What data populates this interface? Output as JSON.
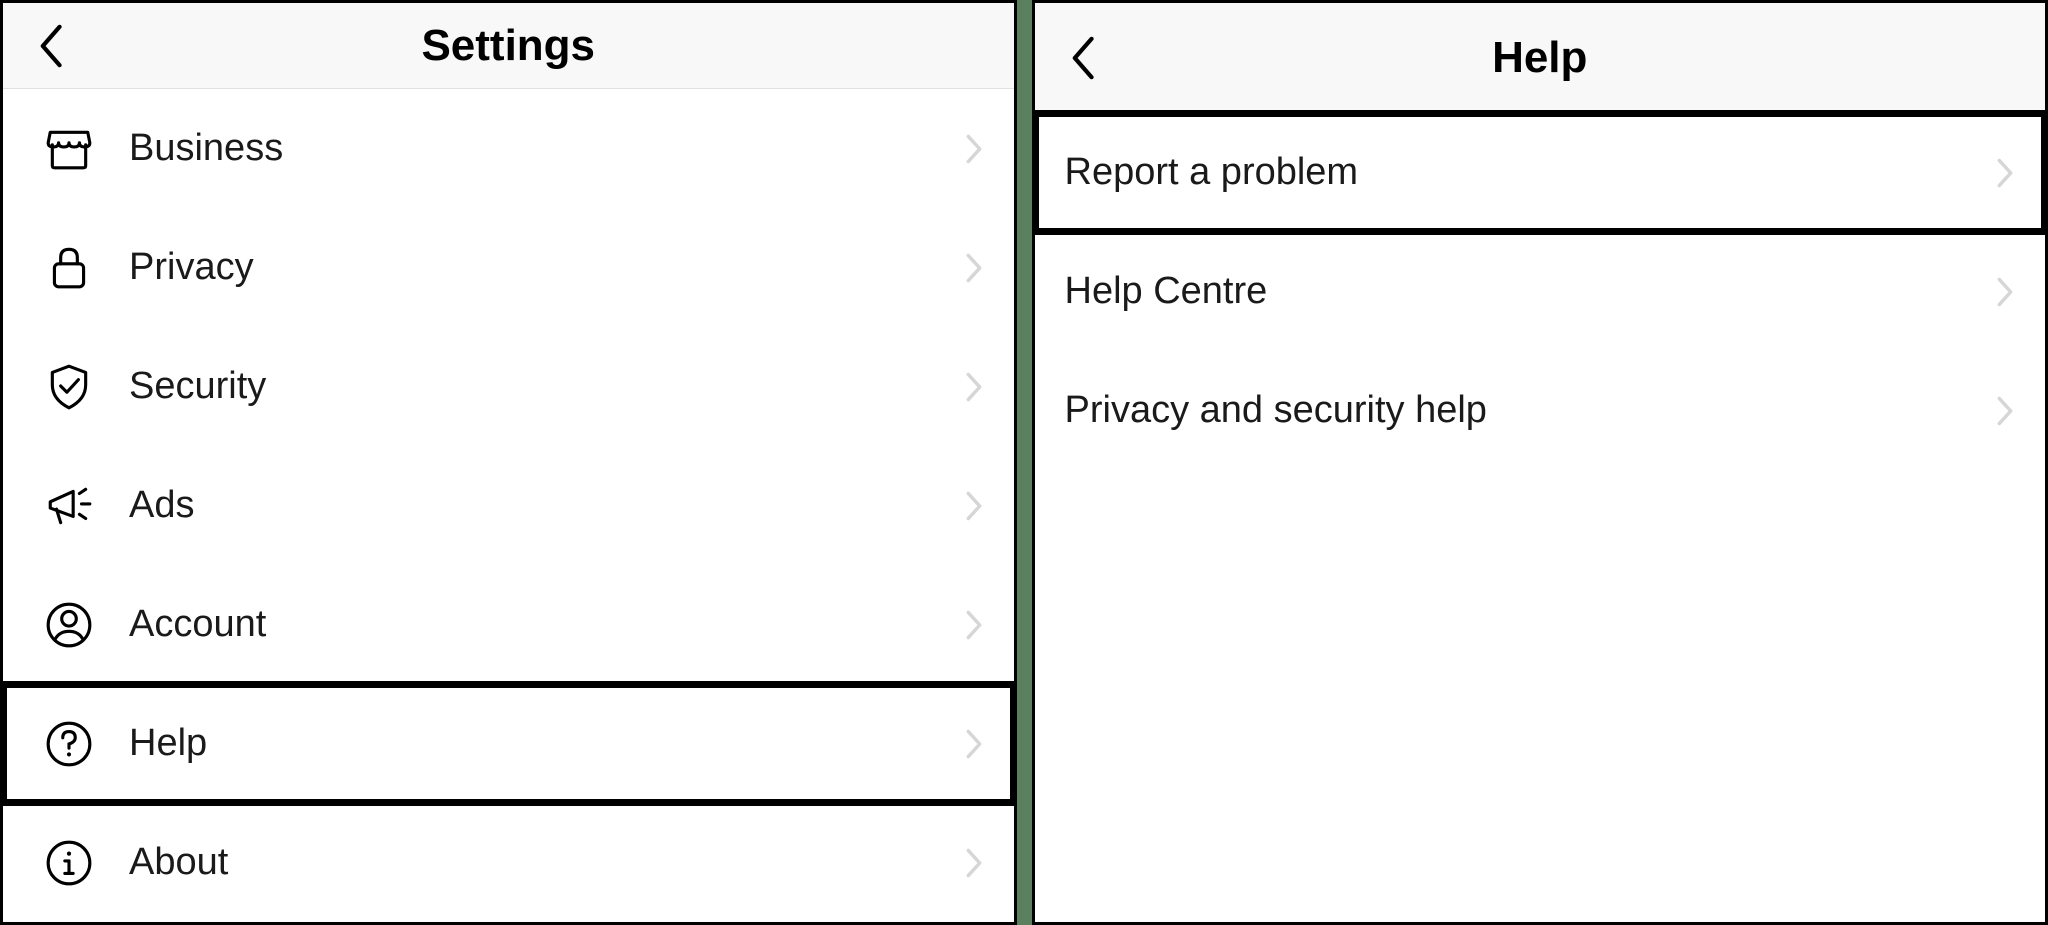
{
  "left": {
    "title": "Settings",
    "items": [
      {
        "icon": "business",
        "label": "Business",
        "highlighted": false
      },
      {
        "icon": "privacy",
        "label": "Privacy",
        "highlighted": false
      },
      {
        "icon": "security",
        "label": "Security",
        "highlighted": false
      },
      {
        "icon": "ads",
        "label": "Ads",
        "highlighted": false
      },
      {
        "icon": "account",
        "label": "Account",
        "highlighted": false
      },
      {
        "icon": "help",
        "label": "Help",
        "highlighted": true
      },
      {
        "icon": "about",
        "label": "About",
        "highlighted": false
      }
    ]
  },
  "right": {
    "title": "Help",
    "items": [
      {
        "label": "Report a problem",
        "highlighted": true
      },
      {
        "label": "Help Centre",
        "highlighted": false
      },
      {
        "label": "Privacy and security help",
        "highlighted": false
      }
    ]
  }
}
